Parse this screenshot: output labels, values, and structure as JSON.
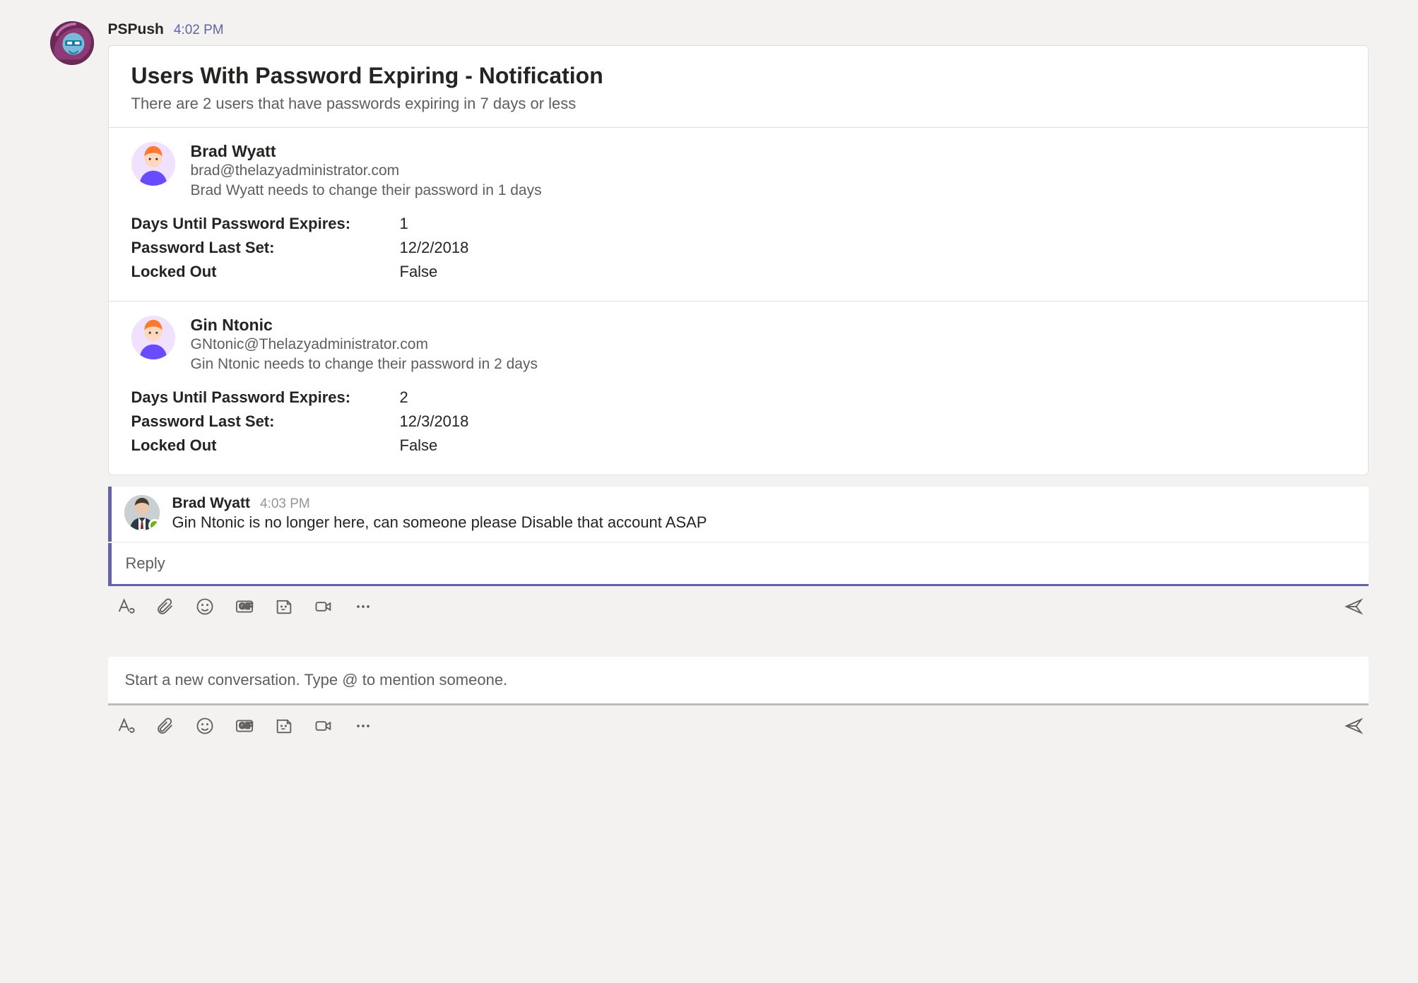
{
  "message": {
    "author": "PSPush",
    "time": "4:02 PM"
  },
  "card": {
    "title": "Users With Password Expiring - Notification",
    "subtitle": "There are 2 users that have passwords expiring in 7 days or less",
    "fact_labels": {
      "days": "Days Until Password Expires:",
      "last_set": "Password Last Set:",
      "locked": "Locked Out"
    },
    "users": [
      {
        "name": "Brad Wyatt",
        "email": "brad@thelazyadministrator.com",
        "note": "Brad Wyatt needs to change their password in 1 days",
        "days": "1",
        "last_set": "12/2/2018",
        "locked": "False"
      },
      {
        "name": "Gin Ntonic",
        "email": "GNtonic@Thelazyadministrator.com",
        "note": "Gin Ntonic needs to change their password in 2 days",
        "days": "2",
        "last_set": "12/3/2018",
        "locked": "False"
      }
    ]
  },
  "reply": {
    "author": "Brad Wyatt",
    "time": "4:03 PM",
    "text": "Gin Ntonic is no longer here, can someone please Disable that account ASAP"
  },
  "reply_input": {
    "placeholder": "Reply"
  },
  "new_convo_input": {
    "placeholder": "Start a new conversation. Type @ to mention someone."
  }
}
